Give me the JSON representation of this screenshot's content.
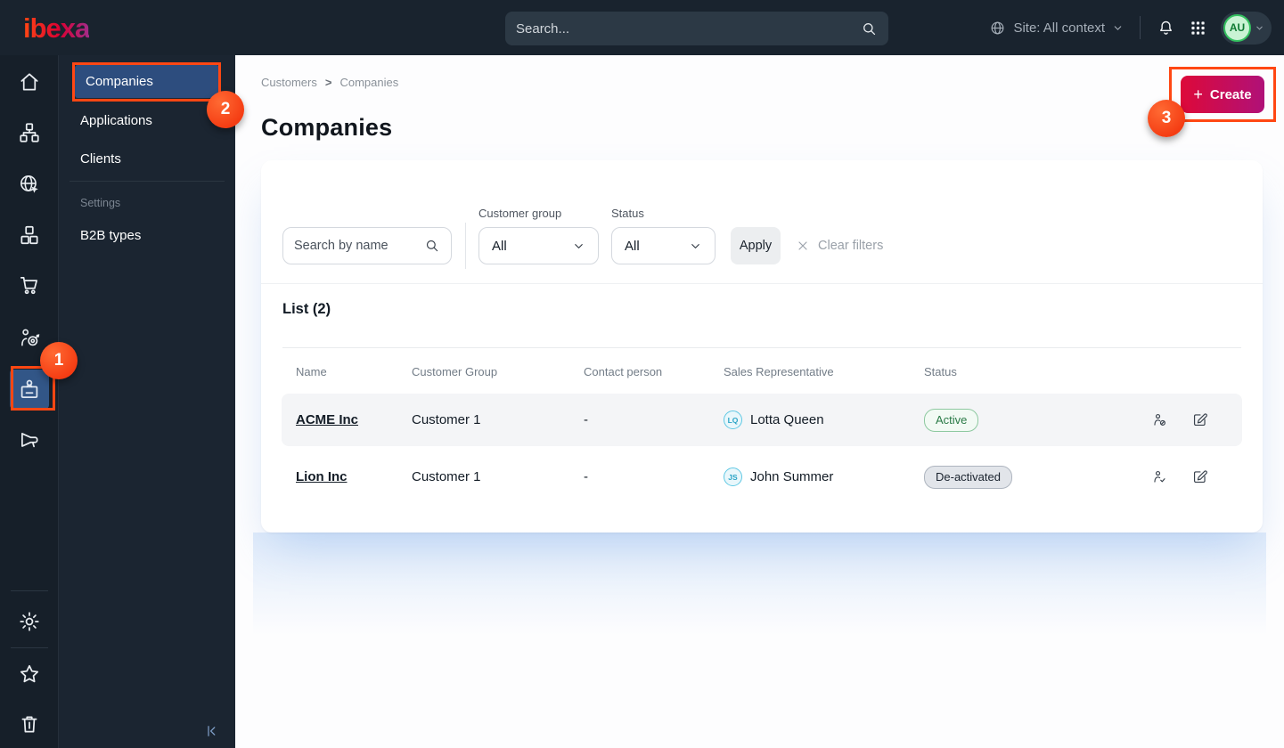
{
  "topbar": {
    "logo_text": "ibexa",
    "search_placeholder": "Search...",
    "site_selector_label": "Site: All context",
    "avatar_initials": "AU"
  },
  "icon_rail": {
    "items": [
      "home-icon",
      "content-tree-icon",
      "site-icon",
      "product-catalog-icon",
      "commerce-icon",
      "segments-icon",
      "customers-icon",
      "promotions-icon"
    ],
    "bottom_items": [
      "settings-icon",
      "bookmarks-icon",
      "trash-icon"
    ],
    "current_item": "customers-icon"
  },
  "sidebar": {
    "items": [
      {
        "label": "Companies",
        "selected": true
      },
      {
        "label": "Applications",
        "selected": false
      },
      {
        "label": "Clients",
        "selected": false
      }
    ],
    "section_label": "Settings",
    "section_items": [
      {
        "label": "B2B types"
      }
    ]
  },
  "main": {
    "breadcrumb": {
      "items": [
        "Customers",
        "Companies"
      ],
      "separator": ">"
    },
    "title": "Companies",
    "create_button": {
      "label": "Create",
      "plus": "+"
    },
    "filters": {
      "search_placeholder": "Search by name",
      "customer_group_label": "Customer group",
      "customer_group_value": "All",
      "status_label": "Status",
      "status_value": "All",
      "apply_label": "Apply",
      "clear_label": "Clear filters"
    },
    "list": {
      "heading": "List (2)",
      "columns": [
        "Name",
        "Customer Group",
        "Contact person",
        "Sales Representative",
        "Status"
      ],
      "rows": [
        {
          "name": "ACME Inc",
          "customer_group": "Customer 1",
          "contact_person": "-",
          "sales_rep": "Lotta Queen",
          "sales_rep_initials": "LQ",
          "status": "Active",
          "status_type": "active"
        },
        {
          "name": "Lion Inc",
          "customer_group": "Customer 1",
          "contact_person": "-",
          "sales_rep": "John Summer",
          "sales_rep_initials": "JS",
          "status": "De-activated",
          "status_type": "deactivated"
        }
      ]
    }
  },
  "annotations": {
    "steps": [
      "1",
      "2",
      "3"
    ]
  },
  "colors": {
    "accent_orange": "#ff4713",
    "brand_gradient_start": "#ff4713",
    "brand_gradient_end": "#a12c8a",
    "button_gradient": [
      "#dd0939",
      "#b01178"
    ],
    "topbar_bg": "#19232e",
    "selected_nav_bg": "#2d4d7e",
    "status_active_text": "#2a7a46",
    "status_deactivated_bg": "#e2e5ea",
    "avatar_green": "#33c05f",
    "rep_avatar_cyan": "#5fc8e4"
  }
}
